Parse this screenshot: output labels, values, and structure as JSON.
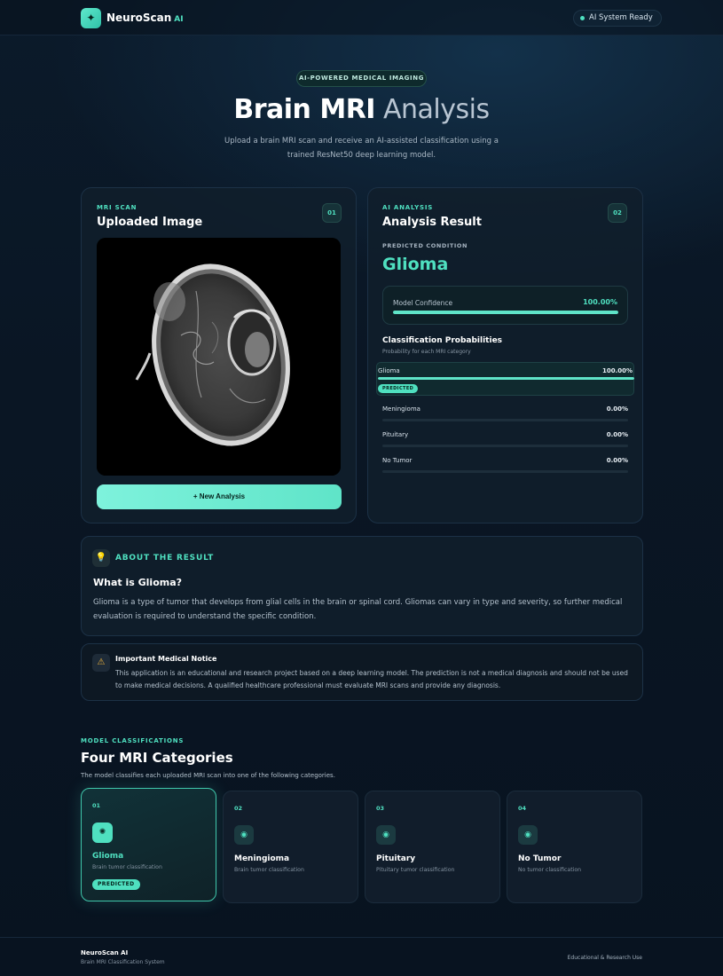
{
  "nav": {
    "logo_icon": "sparkle-icon",
    "brand": "NeuroScan",
    "brand_suffix": "AI",
    "status": "AI System Ready"
  },
  "hero": {
    "badge": "AI-POWERED MEDICAL IMAGING",
    "title_bold": "Brain MRI",
    "title_light": "Analysis",
    "subtitle": "Upload a brain MRI scan and receive an AI-assisted classification using a trained ResNet50 deep learning model."
  },
  "scan_card": {
    "eyebrow": "MRI SCAN",
    "title": "Uploaded Image",
    "number": "01",
    "button": "+ New Analysis"
  },
  "result_card": {
    "eyebrow": "AI ANALYSIS",
    "title": "Analysis Result",
    "number": "02",
    "predicted_label": "PREDICTED CONDITION",
    "predicted": "Glioma",
    "confidence_label": "Model Confidence",
    "confidence": "100.00%",
    "confidence_fraction": 1.0,
    "probs_title": "Classification Probabilities",
    "probs_sub": "Probability for each MRI category",
    "predicted_tag": "PREDICTED",
    "probabilities": [
      {
        "name": "Glioma",
        "value": "100.00%",
        "fraction": 1.0
      },
      {
        "name": "Meningioma",
        "value": "0.00%",
        "fraction": 0
      },
      {
        "name": "Pituitary",
        "value": "0.00%",
        "fraction": 0
      },
      {
        "name": "No Tumor",
        "value": "0.00%",
        "fraction": 0
      }
    ]
  },
  "about": {
    "icon": "lightbulb-icon",
    "heading": "ABOUT THE RESULT",
    "question": "What is Glioma?",
    "text": "Glioma is a type of tumor that develops from glial cells in the brain or spinal cord. Gliomas can vary in type and severity, so further medical evaluation is required to understand the specific condition."
  },
  "notice": {
    "icon": "warning-icon",
    "title": "Important Medical Notice",
    "text": "This application is an educational and research project based on a deep learning model. The prediction is not a medical diagnosis and should not be used to make medical decisions. A qualified healthcare professional must evaluate MRI scans and provide any diagnosis."
  },
  "categories": {
    "eyebrow": "MODEL CLASSIFICATIONS",
    "title": "Four MRI Categories",
    "subtitle": "The model classifies each uploaded MRI scan into one of the following categories.",
    "predicted_tag": "PREDICTED",
    "items": [
      {
        "num": "01",
        "name": "Glioma",
        "desc": "Brain tumor classification",
        "icon": "target-icon"
      },
      {
        "num": "02",
        "name": "Meningioma",
        "desc": "Brain tumor classification",
        "icon": "target-icon"
      },
      {
        "num": "03",
        "name": "Pituitary",
        "desc": "Pituitary tumor classification",
        "icon": "target-icon"
      },
      {
        "num": "04",
        "name": "No Tumor",
        "desc": "No tumor classification",
        "icon": "target-icon"
      }
    ]
  },
  "footer": {
    "brand": "NeuroScan AI",
    "sub": "Brain MRI Classification System",
    "right": "Educational & Research Use"
  },
  "colors": {
    "accent": "#4fe0c0",
    "background": "#0a1624",
    "card": "#101e2c"
  }
}
